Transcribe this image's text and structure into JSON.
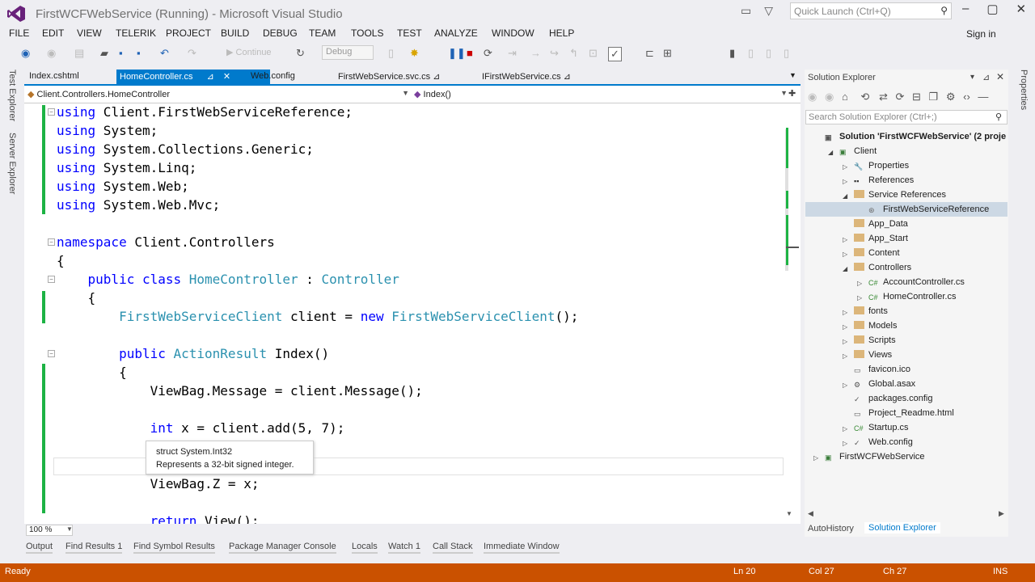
{
  "window": {
    "title": "FirstWCFWebService (Running) - Microsoft Visual Studio",
    "quick_launch_placeholder": "Quick Launch (Ctrl+Q)",
    "sign_in": "Sign in"
  },
  "menu": [
    "FILE",
    "EDIT",
    "VIEW",
    "TELERIK",
    "PROJECT",
    "BUILD",
    "DEBUG",
    "TEAM",
    "TOOLS",
    "TEST",
    "ANALYZE",
    "WINDOW",
    "HELP"
  ],
  "toolbar": {
    "continue_label": "Continue",
    "config_value": "Debug"
  },
  "left_tool_tabs": [
    "Test Explorer",
    "Server Explorer"
  ],
  "doc_tabs": [
    "Index.cshtml",
    "HomeController.cs",
    "Web.config",
    "FirstWebService.svc.cs",
    "IFirstWebService.cs"
  ],
  "nav": {
    "type": "Client.Controllers.HomeController",
    "member": "Index()"
  },
  "code_lines": [
    {
      "line": 1,
      "parts": [
        [
          "kw",
          "using"
        ],
        [
          "t",
          " Client.FirstWebServiceReference;"
        ]
      ]
    },
    {
      "line": 2,
      "parts": [
        [
          "kw",
          "using"
        ],
        [
          "t",
          " System;"
        ]
      ]
    },
    {
      "line": 3,
      "parts": [
        [
          "kw",
          "using"
        ],
        [
          "t",
          " System.Collections.Generic;"
        ]
      ]
    },
    {
      "line": 4,
      "parts": [
        [
          "kw",
          "using"
        ],
        [
          "t",
          " System.Linq;"
        ]
      ]
    },
    {
      "line": 5,
      "parts": [
        [
          "kw",
          "using"
        ],
        [
          "t",
          " System.Web;"
        ]
      ]
    },
    {
      "line": 6,
      "parts": [
        [
          "kw",
          "using"
        ],
        [
          "t",
          " System.Web.Mvc;"
        ]
      ]
    },
    {
      "line": 8,
      "parts": [
        [
          "kw",
          "namespace"
        ],
        [
          "t",
          " Client.Controllers"
        ]
      ]
    },
    {
      "line": 9,
      "parts": [
        [
          "t",
          "{"
        ]
      ]
    },
    {
      "line": 10,
      "parts": [
        [
          "t",
          "    "
        ],
        [
          "kw",
          "public class"
        ],
        [
          "t",
          " "
        ],
        [
          "ty",
          "HomeController"
        ],
        [
          "t",
          " : "
        ],
        [
          "ty",
          "Controller"
        ]
      ]
    },
    {
      "line": 11,
      "parts": [
        [
          "t",
          "    {"
        ]
      ]
    },
    {
      "line": 12,
      "parts": [
        [
          "t",
          "        "
        ],
        [
          "ty",
          "FirstWebServiceClient"
        ],
        [
          "t",
          " client = "
        ],
        [
          "kw",
          "new"
        ],
        [
          "t",
          " "
        ],
        [
          "ty",
          "FirstWebServiceClient"
        ],
        [
          "t",
          "();"
        ]
      ]
    },
    {
      "line": 14,
      "parts": [
        [
          "t",
          "        "
        ],
        [
          "kw",
          "public"
        ],
        [
          "t",
          " "
        ],
        [
          "ty",
          "ActionResult"
        ],
        [
          "t",
          " Index()"
        ]
      ]
    },
    {
      "line": 15,
      "parts": [
        [
          "t",
          "        {"
        ]
      ]
    },
    {
      "line": 16,
      "parts": [
        [
          "t",
          "            ViewBag.Message = client.Message();"
        ]
      ]
    },
    {
      "line": 18,
      "parts": [
        [
          "t",
          "            "
        ],
        [
          "kw",
          "int"
        ],
        [
          "t",
          " x = client.add(5, 7);"
        ]
      ]
    },
    {
      "line": 21,
      "parts": [
        [
          "t",
          "            ViewBag.Z = x;"
        ]
      ]
    },
    {
      "line": 23,
      "parts": [
        [
          "t",
          "            "
        ],
        [
          "kw",
          "return"
        ],
        [
          "t",
          " View();"
        ]
      ]
    }
  ],
  "tooltip": {
    "line1": "struct System.Int32",
    "line2": "Represents a 32-bit signed integer."
  },
  "zoom": "100 %",
  "solution_explorer": {
    "title": "Solution Explorer",
    "search_placeholder": "Search Solution Explorer (Ctrl+;)",
    "items": [
      {
        "label": "Solution 'FirstWCFWebService' (2 proje",
        "icon": "solution-icon",
        "bold": true
      },
      {
        "label": "Client",
        "icon": "project-icon"
      },
      {
        "label": "Properties",
        "icon": "wrench-icon"
      },
      {
        "label": "References",
        "icon": "references-icon"
      },
      {
        "label": "Service References",
        "icon": "folder-icon"
      },
      {
        "label": "FirstWebServiceReference",
        "icon": "service-reference-icon"
      },
      {
        "label": "App_Data",
        "icon": "folder-icon"
      },
      {
        "label": "App_Start",
        "icon": "folder-icon"
      },
      {
        "label": "Content",
        "icon": "folder-icon"
      },
      {
        "label": "Controllers",
        "icon": "folder-icon"
      },
      {
        "label": "AccountController.cs",
        "icon": "csharp-file-icon"
      },
      {
        "label": "HomeController.cs",
        "icon": "csharp-file-icon"
      },
      {
        "label": "fonts",
        "icon": "folder-icon"
      },
      {
        "label": "Models",
        "icon": "folder-icon"
      },
      {
        "label": "Scripts",
        "icon": "folder-icon"
      },
      {
        "label": "Views",
        "icon": "folder-icon"
      },
      {
        "label": "favicon.ico",
        "icon": "image-file-icon"
      },
      {
        "label": "Global.asax",
        "icon": "asax-file-icon"
      },
      {
        "label": "packages.config",
        "icon": "config-file-icon"
      },
      {
        "label": "Project_Readme.html",
        "icon": "html-file-icon"
      },
      {
        "label": "Startup.cs",
        "icon": "csharp-file-icon"
      },
      {
        "label": "Web.config",
        "icon": "config-file-icon"
      },
      {
        "label": "FirstWCFWebService",
        "icon": "project-icon"
      }
    ],
    "bottom_tabs": [
      "AutoHistory",
      "Solution Explorer"
    ]
  },
  "right_tool_tab": "Properties",
  "bottom_tabs": [
    "Output",
    "Find Results 1",
    "Find Symbol Results",
    "Package Manager Console",
    "Locals",
    "Watch 1",
    "Call Stack",
    "Immediate Window"
  ],
  "status": {
    "state": "Ready",
    "ln": "Ln 20",
    "col": "Col 27",
    "ch": "Ch 27",
    "mode": "INS"
  },
  "colors": {
    "accent": "#007acc",
    "status_bar": "#ca5100",
    "keyword": "#0000ff",
    "type": "#2b91af",
    "change_bar": "#1db344"
  }
}
